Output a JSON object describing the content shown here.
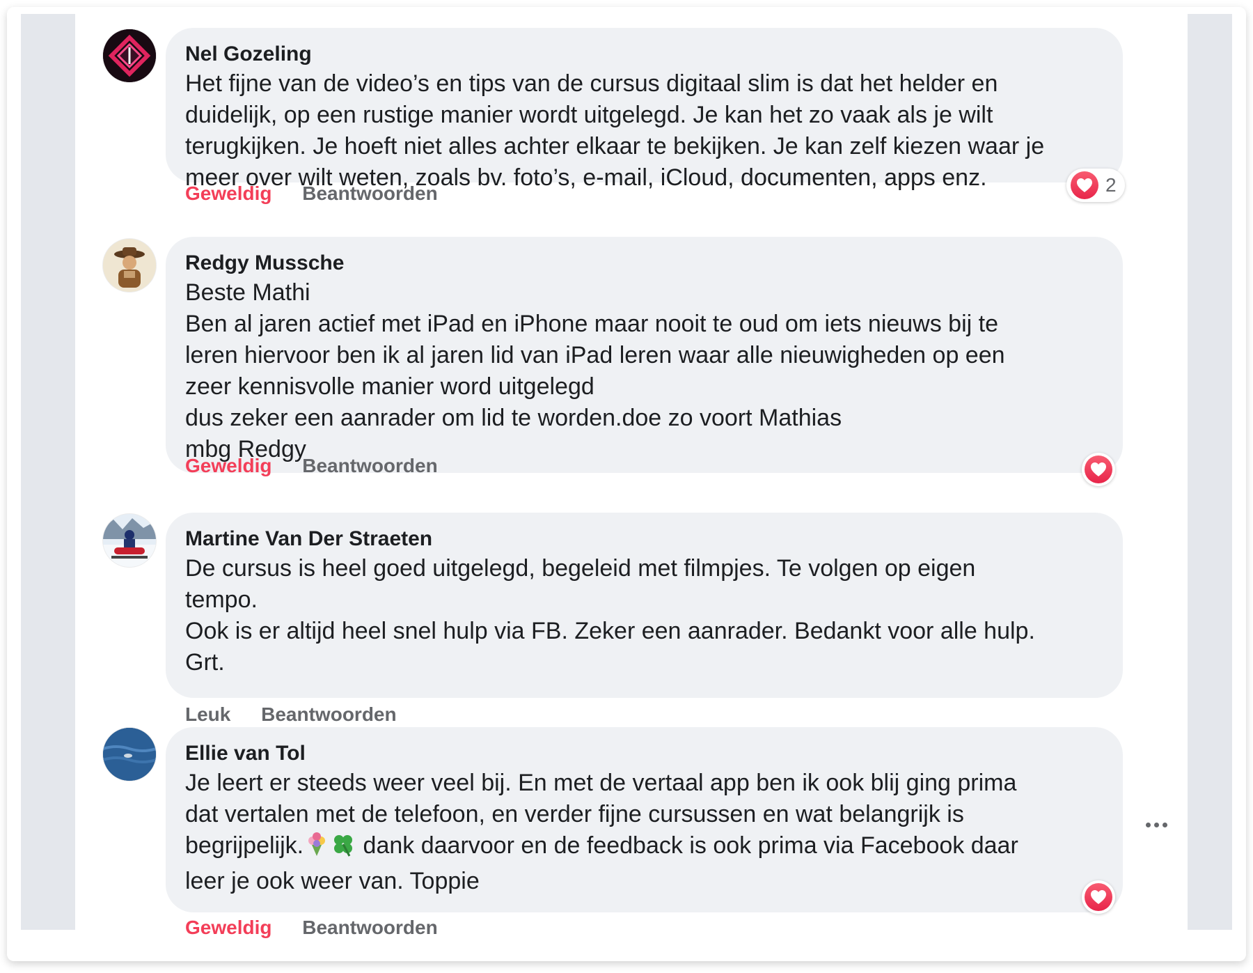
{
  "comments": [
    {
      "author": "Nel Gozeling",
      "avatar_icon": "diamond-logo-avatar",
      "text": "Het fijne van de video’s en tips van de cursus digitaal slim is dat het helder en\nduidelijk, op een rustige manier wordt uitgelegd. Je kan het zo vaak als je wilt\nterugkijken. Je hoeft niet alles achter elkaar te bekijken. Je kan zelf kiezen waar je\nmeer over wilt weten, zoals bv. foto’s, e-mail, iCloud, documenten, apps enz.",
      "reaction_label": "Geweldig",
      "reply_label": "Beantwoorden",
      "reaction_icon": "heart-icon",
      "reaction_count": "2"
    },
    {
      "author": "Redgy Mussche",
      "avatar_icon": "cowboy-photo-avatar",
      "text": "Beste Mathi\nBen al jaren actief met iPad en iPhone maar nooit te oud om iets nieuws bij te\nleren hiervoor ben ik al jaren lid van iPad leren waar alle nieuwigheden op een\nzeer kennisvolle manier word uitgelegd\ndus zeker een aanrader om lid te worden.doe zo voort Mathias\nmbg Redgy",
      "reaction_label": "Geweldig",
      "reply_label": "Beantwoorden",
      "reaction_icon": "heart-icon"
    },
    {
      "author": "Martine Van Der Straeten",
      "avatar_icon": "snowmobile-photo-avatar",
      "text": "De cursus is heel goed uitgelegd, begeleid met filmpjes. Te volgen op eigen\ntempo.\nOok is er altijd heel snel hulp via FB. Zeker een aanrader. Bedankt voor alle hulp.\nGrt.",
      "reaction_label": "Leuk",
      "reply_label": "Beantwoorden"
    },
    {
      "author": "Ellie van Tol",
      "avatar_icon": "sea-photo-avatar",
      "text_before_emoji": "Je leert er steeds weer veel bij. En met de vertaal app ben ik ook blij ging prima\ndat vertalen met de telefoon, en verder fijne cursussen en wat belangrijk is\nbegrijpelijk.",
      "emoji_icons": [
        "bouquet-emoji-icon",
        "four-leaf-clover-emoji-icon"
      ],
      "text_after_emoji": " dank daarvoor en de feedback is ook prima via Facebook daar\nleer je ook weer van. Toppie",
      "reaction_label": "Geweldig",
      "reply_label": "Beantwoorden",
      "reaction_icon": "heart-icon",
      "more_icon": "more-options-icon"
    }
  ],
  "colors": {
    "love": "#f33e58",
    "bubble": "#eff1f4",
    "secondary_text": "#65676b",
    "gutter": "#e4e7ec"
  }
}
